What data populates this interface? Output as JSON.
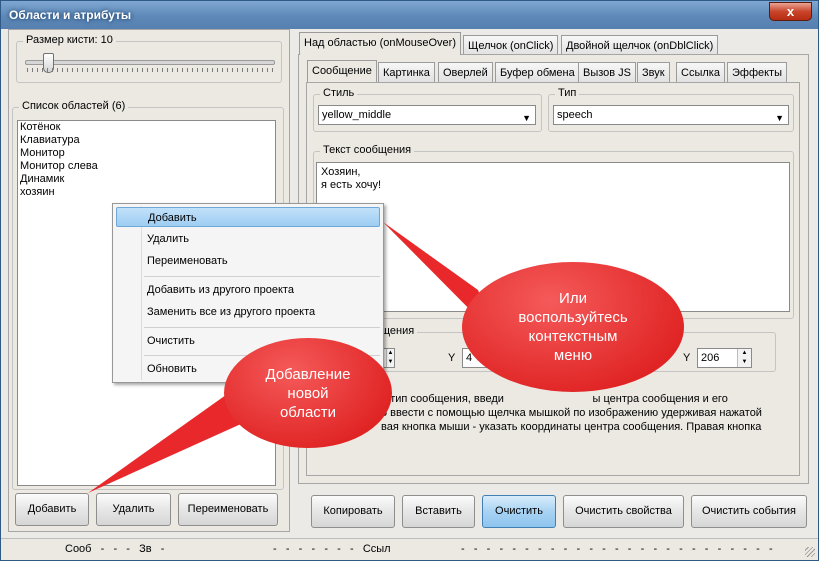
{
  "window": {
    "title": "Области и атрибуты",
    "close_glyph": "x"
  },
  "brush": {
    "label": "Размер кисти: 10",
    "value": 10
  },
  "areas": {
    "title": "Список областей (6)",
    "items": [
      "Котёнок",
      "Клавиатура",
      "Монитор",
      "Монитор слева",
      "Динамик",
      "хозяин"
    ]
  },
  "left_buttons": {
    "add": "Добавить",
    "delete": "Удалить",
    "rename": "Переименовать"
  },
  "event_tabs": [
    "Над областью (onMouseOver)",
    "Щелчок (onClick)",
    "Двойной щелчок (onDblClick)"
  ],
  "prop_tabs": [
    "Сообщение",
    "Картинка",
    "Оверлей",
    "Буфер обмена",
    "Вызов JS",
    "Звук",
    "Ссылка",
    "Эффекты"
  ],
  "style": {
    "title": "Стиль",
    "value": "yellow_middle"
  },
  "type": {
    "title": "Тип",
    "value": "speech"
  },
  "message": {
    "title": "Текст сообщения",
    "line1": "Хозяин,",
    "line2": "я есть хочу!"
  },
  "coords": {
    "title_partial": "щения",
    "y1_label": "Y",
    "y1_partial": "4",
    "y2_label": "Y",
    "y2_value": "206"
  },
  "help_text": {
    "line1": "и тип сообщения, введи                             ы центра сообщения и его",
    "line2": "о ввести с помощью щелчка мышкой по изображению удерживая нажатой",
    "line3": "вая кнопка мыши - указать координаты центра сообщения. Правая кнопка"
  },
  "bottom_buttons": {
    "copy": "Копировать",
    "paste": "Вставить",
    "clear": "Очистить",
    "clear_props": "Очистить свойства",
    "clear_events": "Очистить события"
  },
  "context_menu": {
    "add": "Добавить",
    "delete": "Удалить",
    "rename": "Переименовать",
    "add_from_project": "Добавить из другого проекта",
    "replace_from_project": "Заменить все из другого проекта",
    "clear": "Очистить",
    "refresh": "Обновить"
  },
  "callouts": {
    "left": {
      "line1": "Добавление",
      "line2": "новой",
      "line3": "области"
    },
    "right": {
      "line1": "Или",
      "line2": "воспользуйтесь",
      "line3": "контекстным",
      "line4": "меню"
    }
  },
  "status": {
    "seg1": "Сооб   -   -   -   Зв   -",
    "seg2": "-   -   -   -   -   -   -   Ссыл",
    "seg3": "-   -   -   -   -   -   -   -   -   -   -   -   -   -   -   -   -   -   -   -   -   -   -   -   -"
  },
  "colors": {
    "callout": "#e8282a",
    "title_bar": "#5d88b8",
    "highlight": "#9dcdf2"
  }
}
